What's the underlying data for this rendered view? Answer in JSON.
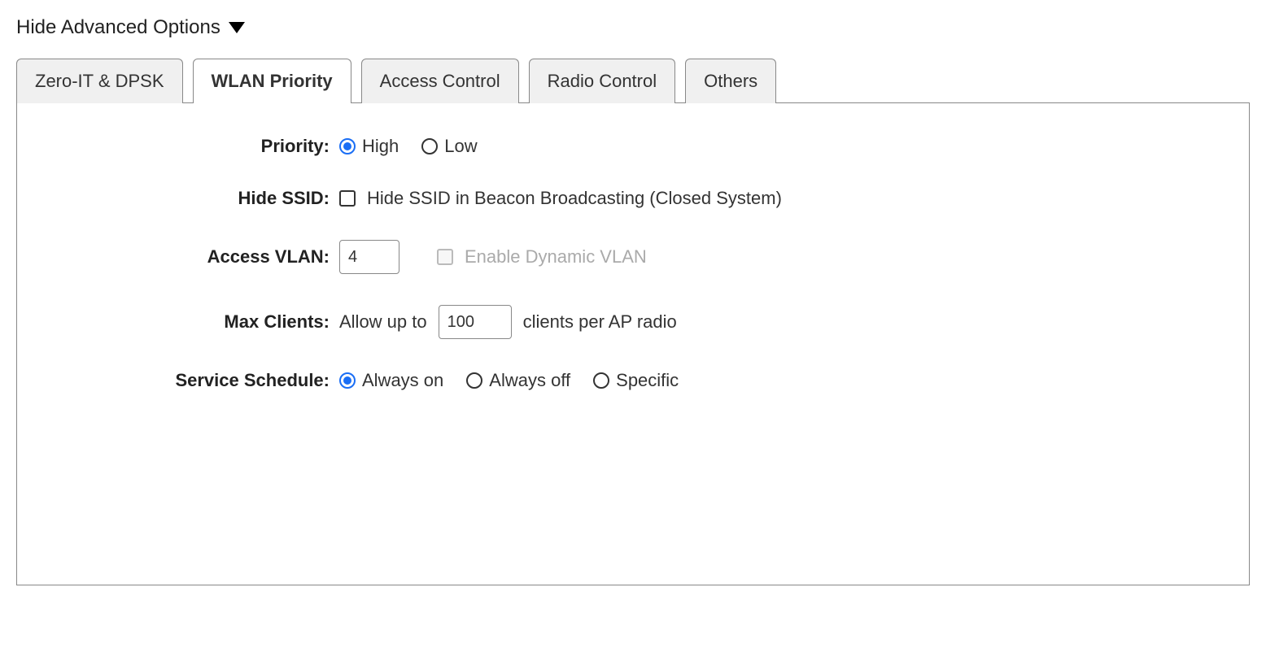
{
  "header": {
    "toggle_label": "Hide Advanced Options"
  },
  "tabs": [
    {
      "label": "Zero-IT & DPSK",
      "active": false
    },
    {
      "label": "WLAN Priority",
      "active": true
    },
    {
      "label": "Access Control",
      "active": false
    },
    {
      "label": "Radio Control",
      "active": false
    },
    {
      "label": "Others",
      "active": false
    }
  ],
  "priority": {
    "label": "Priority:",
    "options": {
      "high": "High",
      "low": "Low"
    },
    "selected": "high"
  },
  "hide_ssid": {
    "label": "Hide SSID:",
    "checkbox_label": "Hide SSID in Beacon Broadcasting (Closed System)",
    "checked": false
  },
  "access_vlan": {
    "label": "Access VLAN:",
    "value": "4",
    "dynamic_vlan_label": "Enable Dynamic VLAN",
    "dynamic_vlan_checked": false,
    "dynamic_vlan_disabled": true
  },
  "max_clients": {
    "label": "Max Clients:",
    "prefix_text": "Allow up to",
    "value": "100",
    "suffix_text": "clients per AP radio"
  },
  "service_schedule": {
    "label": "Service Schedule:",
    "options": {
      "always_on": "Always on",
      "always_off": "Always off",
      "specific": "Specific"
    },
    "selected": "always_on"
  }
}
